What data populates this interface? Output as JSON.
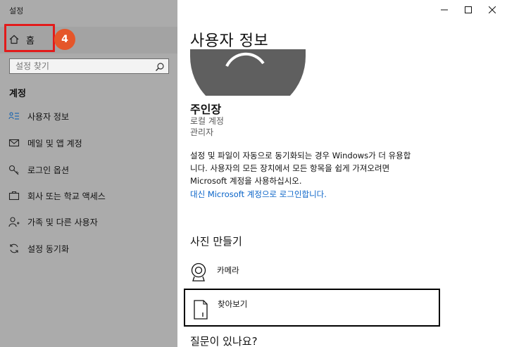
{
  "window": {
    "app_title": "설정"
  },
  "sidebar": {
    "home_label": "홈",
    "step_badge": "4",
    "search_placeholder": "설정 찾기",
    "group_label": "계정",
    "items": [
      {
        "label": "사용자 정보",
        "icon": "person-card-icon"
      },
      {
        "label": "메일 및 앱 계정",
        "icon": "mail-icon"
      },
      {
        "label": "로그인 옵션",
        "icon": "key-icon"
      },
      {
        "label": "회사 또는 학교 액세스",
        "icon": "briefcase-icon"
      },
      {
        "label": "가족 및 다른 사용자",
        "icon": "person-add-icon"
      },
      {
        "label": "설정 동기화",
        "icon": "sync-icon"
      }
    ]
  },
  "main": {
    "title": "사용자 정보",
    "user_name": "주인장",
    "account_type": "로컬 계정",
    "account_role": "관리자",
    "info_lines": [
      "설정 및 파일이 자동으로 동기화되는 경우 Windows가 더 유용합",
      "니다. 사용자의 모든 장치에서 모든 항목을 쉽게 가져오려면",
      "Microsoft 계정을 사용하십시오."
    ],
    "ms_link": "대신 Microsoft 계정으로 로그인합니다.",
    "photo_heading": "사진 만들기",
    "camera_label": "카메라",
    "browse_label": "찾아보기",
    "question_heading": "질문이 있나요?"
  },
  "colors": {
    "sidebar_bg": "#ababab",
    "highlight": "#e21b1b",
    "badge": "#e5562a",
    "link": "#0a64c8"
  }
}
